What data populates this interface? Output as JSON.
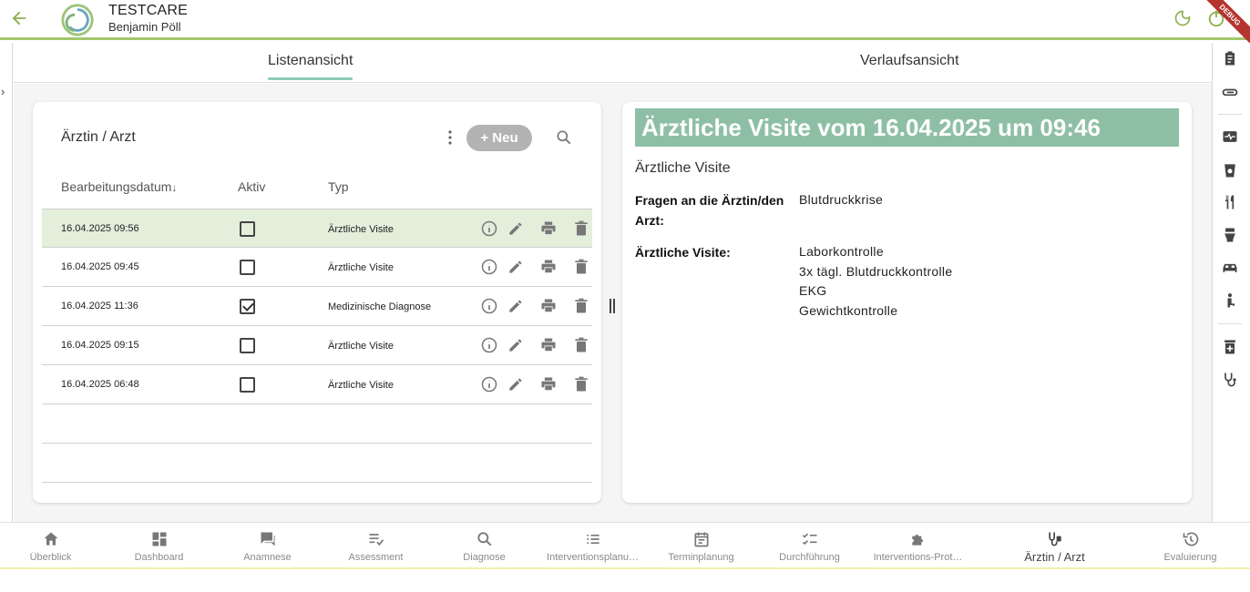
{
  "header": {
    "title": "TESTCARE",
    "user": "Benjamin Pöll",
    "debug_label": "DEBUG"
  },
  "tabs": [
    {
      "label": "Listenansicht",
      "active": true
    },
    {
      "label": "Verlaufsansicht",
      "active": false
    }
  ],
  "list": {
    "title": "Ärztin / Arzt",
    "new_label": "+ Neu",
    "columns": {
      "date": "Bearbeitungsdatum",
      "sort_indicator": "↓",
      "active": "Aktiv",
      "type": "Typ"
    },
    "rows": [
      {
        "date": "16.04.2025 09:56",
        "active": false,
        "type": "Ärztliche Visite",
        "selected": true
      },
      {
        "date": "16.04.2025 09:45",
        "active": false,
        "type": "Ärztliche Visite",
        "selected": false
      },
      {
        "date": "16.04.2025 11:36",
        "active": true,
        "type": "Medizinische Diagnose",
        "selected": false
      },
      {
        "date": "16.04.2025 09:15",
        "active": false,
        "type": "Ärztliche Visite",
        "selected": false
      },
      {
        "date": "16.04.2025 06:48",
        "active": false,
        "type": "Ärztliche Visite",
        "selected": false
      }
    ]
  },
  "detail": {
    "title": "Ärztliche Visite vom 16.04.2025 um 09:46",
    "subtitle": "Ärztliche Visite",
    "fields": [
      {
        "label_line1": "Fragen an die Ärztin/den",
        "label_line2": "Arzt:",
        "values": [
          "Blutdruckkrise"
        ]
      },
      {
        "label_line1": "Ärztliche Visite:",
        "label_line2": "",
        "values": [
          "Laborkontrolle",
          "3x tägl. Blutdruckkontrolle",
          "EKG",
          "Gewichtkontrolle"
        ]
      }
    ]
  },
  "bottom_nav": [
    {
      "label": "Überblick",
      "icon": "home-icon"
    },
    {
      "label": "Dashboard",
      "icon": "dashboard-icon"
    },
    {
      "label": "Anamnese",
      "icon": "chat-icon"
    },
    {
      "label": "Assessment",
      "icon": "assessment-icon"
    },
    {
      "label": "Diagnose",
      "icon": "search-icon"
    },
    {
      "label": "Interventionsplanu…",
      "icon": "list-icon"
    },
    {
      "label": "Terminplanung",
      "icon": "calendar-icon"
    },
    {
      "label": "Durchführung",
      "icon": "checklist-icon"
    },
    {
      "label": "Interventions-Prot…",
      "icon": "puzzle-icon"
    },
    {
      "label": "Ärztin / Arzt",
      "icon": "doctor-icon",
      "active": true
    },
    {
      "label": "Evaluierung",
      "icon": "history-icon"
    }
  ],
  "colors": {
    "accent": "#8bb04f",
    "title_bar": "#8ebfa5",
    "selected_row": "#e3eedb",
    "tab_indicator": "#8ecbb9"
  }
}
